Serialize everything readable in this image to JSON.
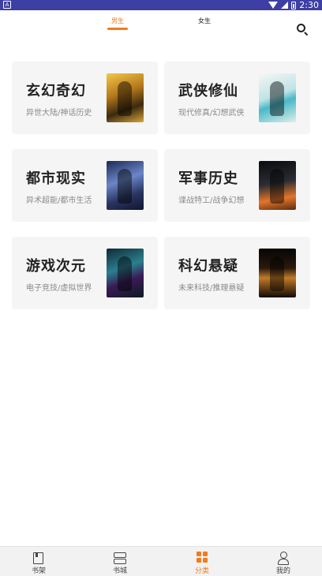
{
  "status_bar": {
    "left_badge": "A",
    "time": "2:30"
  },
  "top_tabs": {
    "active": "男生",
    "inactive": "女生"
  },
  "icons": {
    "search": "search-icon",
    "bookshelf": "book-icon",
    "store": "store-icon",
    "category": "grid-icon",
    "profile": "user-icon"
  },
  "colors": {
    "accent": "#f27b1c",
    "status_bar": "#3d3fa5",
    "card_bg": "#f5f5f5"
  },
  "categories": [
    {
      "title": "玄幻奇幻",
      "subtitle": "异世大陆/神话历史"
    },
    {
      "title": "武侠修仙",
      "subtitle": "现代修真/幻想武侠"
    },
    {
      "title": "都市现实",
      "subtitle": "异术超能/都市生活"
    },
    {
      "title": "军事历史",
      "subtitle": "谍战特工/战争幻想"
    },
    {
      "title": "游戏次元",
      "subtitle": "电子竞技/虚拟世界"
    },
    {
      "title": "科幻悬疑",
      "subtitle": "未来科技/推理悬疑"
    }
  ],
  "bottom_nav": {
    "items": [
      {
        "label": "书架"
      },
      {
        "label": "书城"
      },
      {
        "label": "分类"
      },
      {
        "label": "我的"
      }
    ],
    "active_index": 2
  }
}
